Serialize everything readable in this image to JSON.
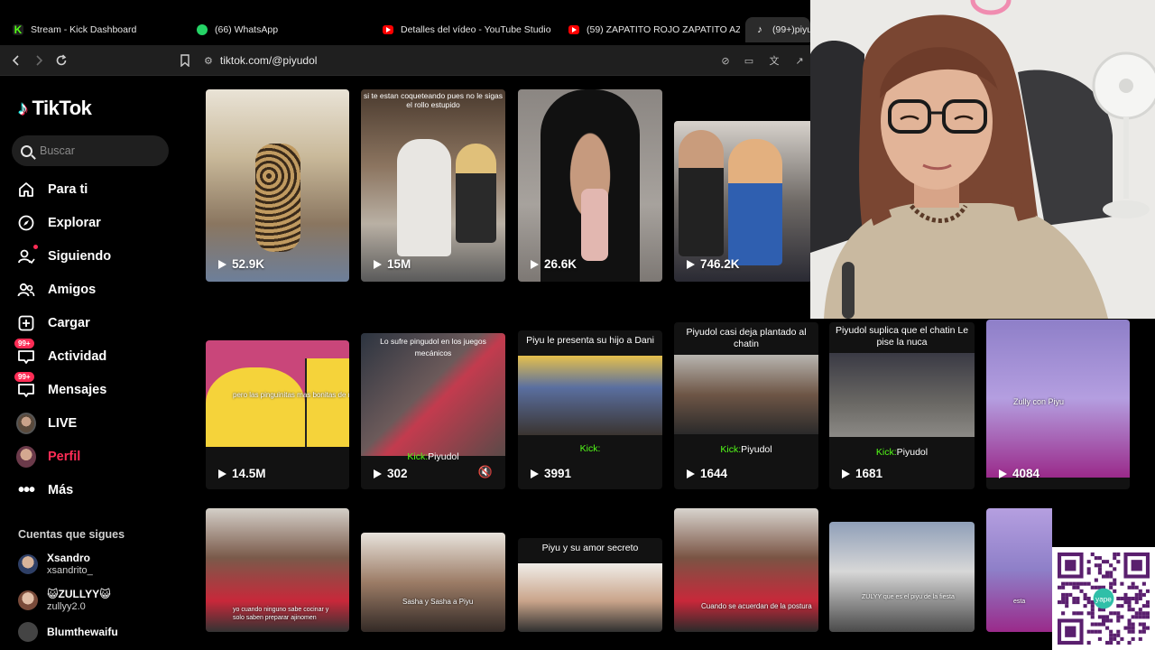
{
  "browser": {
    "tabs": [
      {
        "label": "Stream - Kick Dashboard",
        "icon": "kick-icon"
      },
      {
        "label": "(66) WhatsApp",
        "icon": "whatsapp-icon"
      },
      {
        "label": "Detalles del vídeo - YouTube Studio",
        "icon": "youtube-icon"
      },
      {
        "label": "(59) ZAPATITO ROJO ZAPATITO AZUL",
        "icon": "youtube-icon"
      },
      {
        "label": "(99+)piyu",
        "icon": "tiktok-icon"
      }
    ],
    "url": "tiktok.com/@piyudol"
  },
  "sidebar": {
    "logo": "TikTok",
    "search_placeholder": "Buscar",
    "nav": [
      {
        "label": "Para ti",
        "icon": "home-icon"
      },
      {
        "label": "Explorar",
        "icon": "compass-icon"
      },
      {
        "label": "Siguiendo",
        "icon": "following-icon"
      },
      {
        "label": "Amigos",
        "icon": "friends-icon"
      },
      {
        "label": "Cargar",
        "icon": "upload-icon"
      },
      {
        "label": "Actividad",
        "icon": "activity-icon",
        "badge": "99+"
      },
      {
        "label": "Mensajes",
        "icon": "messages-icon",
        "badge": "99+"
      },
      {
        "label": "LIVE",
        "icon": "live-icon"
      },
      {
        "label": "Perfil",
        "icon": "profile-icon"
      },
      {
        "label": "Más",
        "icon": "more-icon"
      }
    ],
    "following_title": "Cuentas que sigues",
    "accounts": [
      {
        "name": "Xsandro",
        "handle": "xsandrito_"
      },
      {
        "name": "😺ZULLYY😺",
        "handle": "zullyy2.0"
      },
      {
        "name": "Blumthewaifu",
        "handle": ""
      }
    ]
  },
  "videos": [
    {
      "views": "52.9K",
      "caption": "",
      "kick": ""
    },
    {
      "views": "15M",
      "caption": "si te estan coqueteando pues no le sigas el rollo estupido",
      "kick": ""
    },
    {
      "views": "26.6K",
      "caption": "",
      "kick": ""
    },
    {
      "views": "746.2K",
      "caption": "",
      "kick": ""
    },
    {
      "views": "14.5M",
      "caption": "",
      "overlay": "pero las pinguinitas mas bonitas de miel",
      "kick": ""
    },
    {
      "views": "302",
      "caption": "Lo sufre pingudol en los juegos mecánicos",
      "kick": "Piyudol",
      "muted": true
    },
    {
      "views": "3991",
      "caption": "Piyu le presenta su hijo a Dani",
      "kick": ""
    },
    {
      "views": "1644",
      "caption": "Piyudol casi deja plantado al chatin",
      "kick": "Piyudol"
    },
    {
      "views": "1681",
      "caption": "Piyudol suplica que el chatin Le pise la nuca",
      "kick": "Piyudol"
    },
    {
      "views": "4084",
      "caption": "",
      "overlay": "Zully con Piyu",
      "kick": ""
    },
    {
      "views": "",
      "caption": "",
      "overlay": "yo cuando ninguno sabe cocinar y solo saben preparar ajinomen",
      "kick": ""
    },
    {
      "views": "",
      "caption": "",
      "overlay": "Sasha y Sasha a Piyu",
      "kick": ""
    },
    {
      "views": "",
      "caption": "Piyu y su amor secreto",
      "kick": ""
    },
    {
      "views": "",
      "caption": "",
      "overlay": "Cuando se acuerdan de la postura",
      "kick": ""
    },
    {
      "views": "",
      "caption": "",
      "overlay": "ZULYY que es el piyu de la fiesta",
      "kick": ""
    },
    {
      "views": "",
      "caption": "",
      "overlay": "esta",
      "kick": ""
    }
  ],
  "kick_prefix": "Kick:",
  "qr_label": "yape",
  "colors": {
    "accent": "#fe2c55",
    "kick_green": "#53fc18",
    "background": "#000000"
  }
}
